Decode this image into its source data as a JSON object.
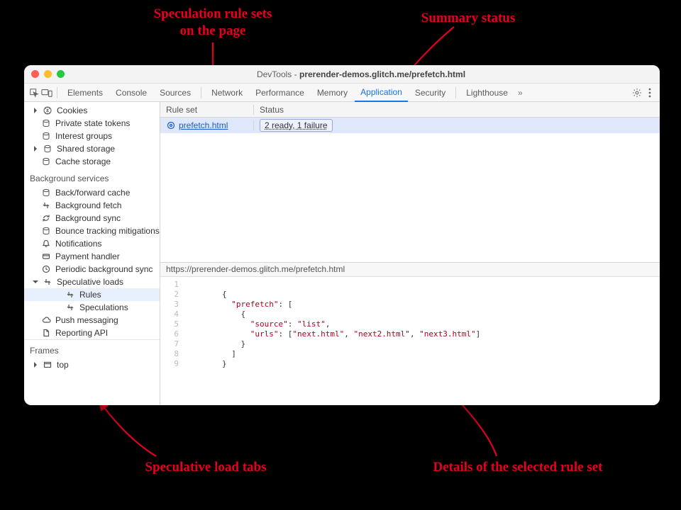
{
  "annotations": {
    "rule_sets": "Speculation rule sets\non the page",
    "summary_status": "Summary status",
    "load_tabs": "Speculative load tabs",
    "details": "Details of the selected rule set"
  },
  "window_title_prefix": "DevTools - ",
  "window_title_main": "prerender-demos.glitch.me/prefetch.html",
  "tabs": {
    "elements": "Elements",
    "console": "Console",
    "sources": "Sources",
    "network": "Network",
    "performance": "Performance",
    "memory": "Memory",
    "application": "Application",
    "security": "Security",
    "lighthouse": "Lighthouse",
    "more": "»"
  },
  "sidebar": {
    "cookies": "Cookies",
    "private_state_tokens": "Private state tokens",
    "interest_groups": "Interest groups",
    "shared_storage": "Shared storage",
    "cache_storage": "Cache storage",
    "bg_services": "Background services",
    "back_forward_cache": "Back/forward cache",
    "background_fetch": "Background fetch",
    "background_sync": "Background sync",
    "bounce_tracking": "Bounce tracking mitigations",
    "notifications": "Notifications",
    "payment_handler": "Payment handler",
    "periodic_bg_sync": "Periodic background sync",
    "speculative_loads": "Speculative loads",
    "rules": "Rules",
    "speculations": "Speculations",
    "push_messaging": "Push messaging",
    "reporting_api": "Reporting API",
    "frames": "Frames",
    "top": "top"
  },
  "rules_table": {
    "col_ruleset": "Rule set",
    "col_status": "Status",
    "row0_ruleset": "prefetch.html",
    "row0_status": "2 ready, 1 failure",
    "detail_url": "https://prerender-demos.glitch.me/prefetch.html"
  },
  "code": {
    "l1": "",
    "l2": "{",
    "l3a": "  \"prefetch\"",
    "l3b": ": [",
    "l4": "    {",
    "l5a": "      \"source\"",
    "l5b": ": ",
    "l5c": "\"list\"",
    "l5d": ",",
    "l6a": "      \"urls\"",
    "l6b": ": [",
    "l6c": "\"next.html\"",
    "l6d": ", ",
    "l6e": "\"next2.html\"",
    "l6f": ", ",
    "l6g": "\"next3.html\"",
    "l6h": "]",
    "l7": "    }",
    "l8": "  ]",
    "l9": "}"
  }
}
